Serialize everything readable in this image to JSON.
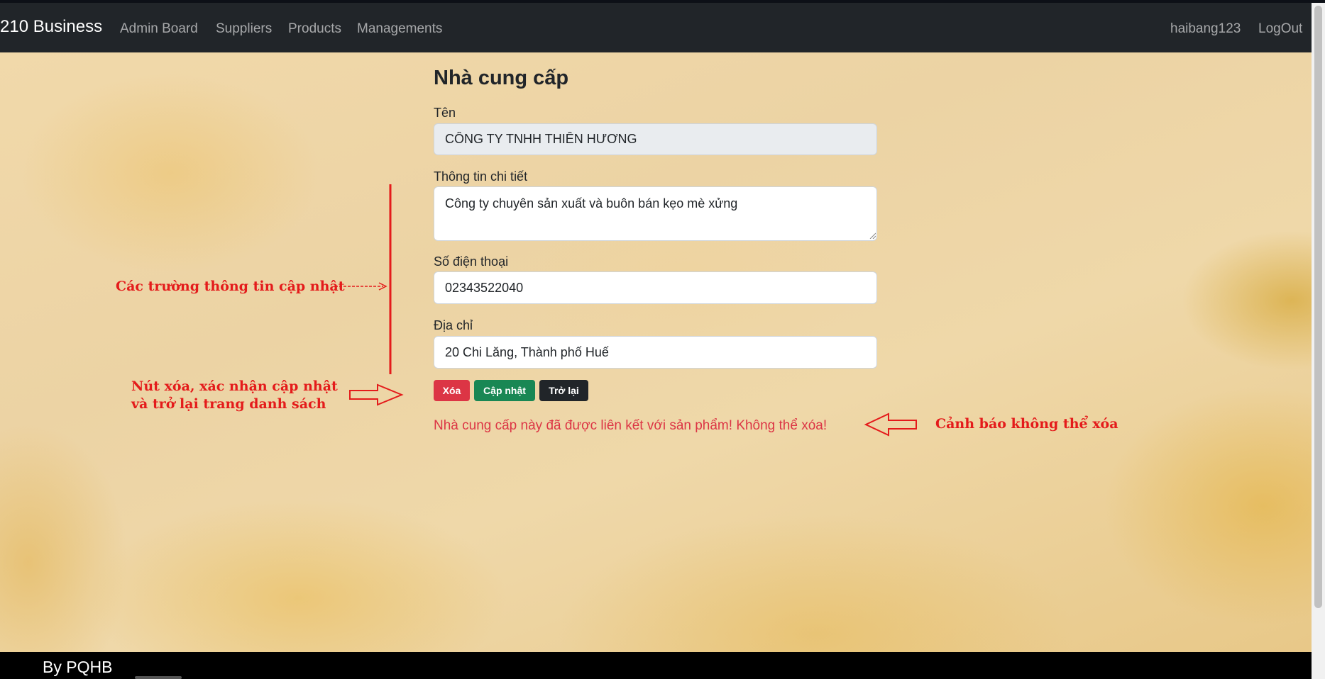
{
  "navbar": {
    "brand": "210 Business",
    "links": [
      "Admin Board",
      "Suppliers",
      "Products",
      "Managements"
    ],
    "user": "haibang123",
    "logout": "LogOut"
  },
  "form": {
    "title": "Nhà cung cấp",
    "name": {
      "label": "Tên",
      "value": "CÔNG TY TNHH THIÊN HƯƠNG"
    },
    "details": {
      "label": "Thông tin chi tiết",
      "value": "Công ty chuyên sản xuất và buôn bán kẹo mè xửng"
    },
    "phone": {
      "label": "Số điện thoại",
      "value": "02343522040"
    },
    "address": {
      "label": "Địa chỉ",
      "value": "20 Chi Lăng, Thành phố Huế"
    },
    "buttons": {
      "delete": "Xóa",
      "update": "Cập nhật",
      "back": "Trở lại"
    },
    "warning": "Nhà cung cấp này đã được liên kết với sản phẩm! Không thể xóa!"
  },
  "annotations": {
    "fields_note": "Các trường thông tin cập nhật",
    "buttons_note_line1": "Nút xóa, xác nhận cập nhật",
    "buttons_note_line2": "và trở lại trang danh sách",
    "warning_note": "Cảnh báo không thể xóa",
    "color": "#e41b1b"
  },
  "footer": {
    "text": "By PQHB"
  }
}
